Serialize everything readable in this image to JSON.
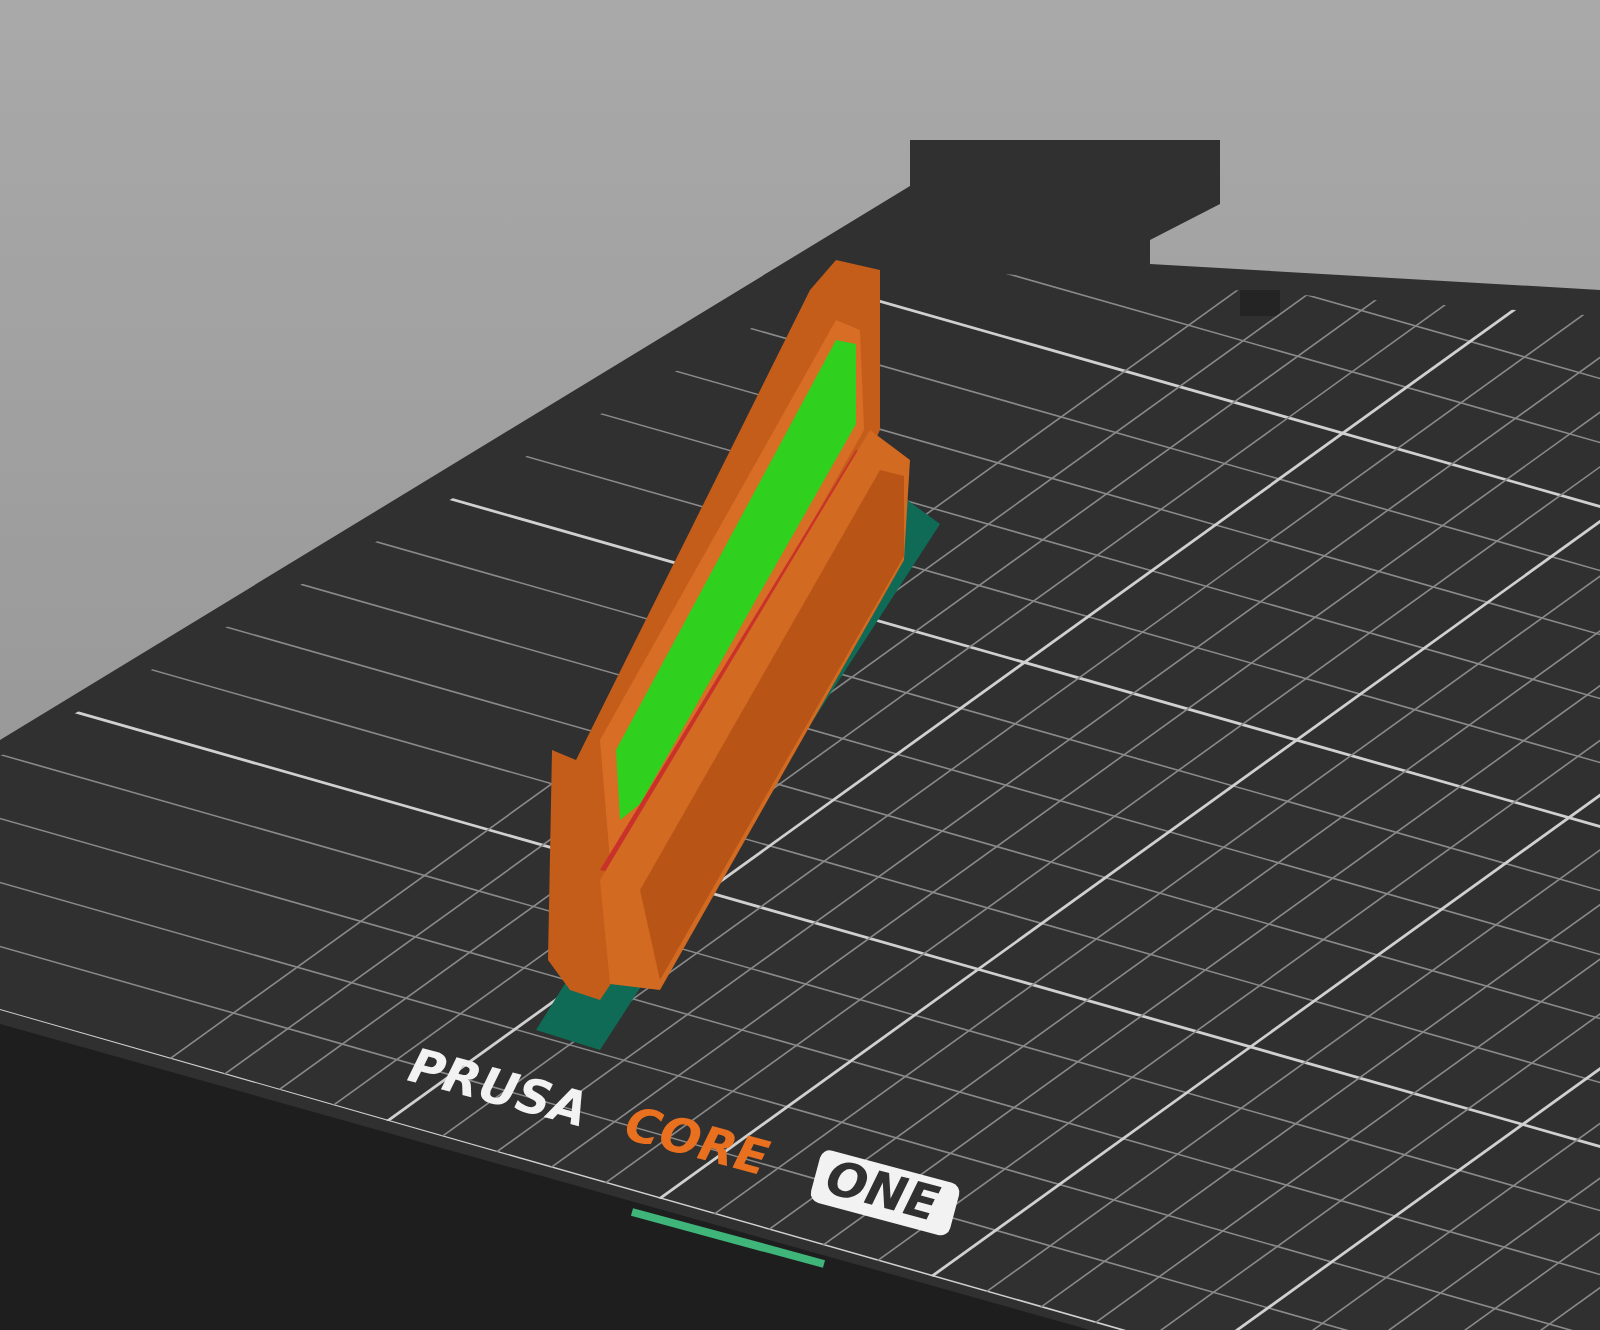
{
  "bed_logo": {
    "brand": "PRUSA",
    "model": "CORE",
    "variant": "ONE"
  }
}
